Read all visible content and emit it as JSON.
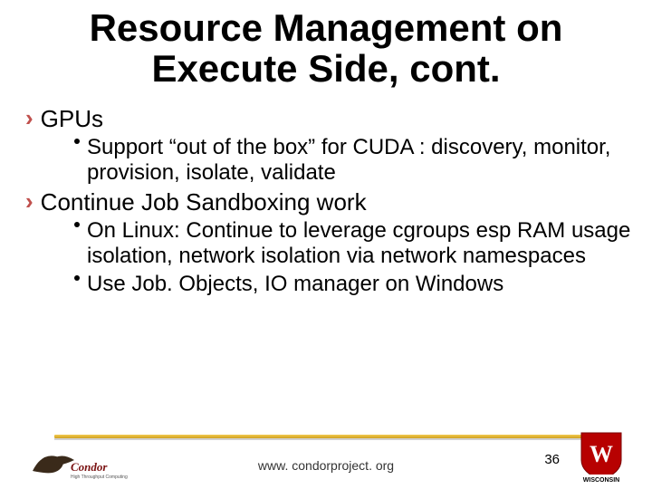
{
  "title": "Resource Management on Execute Side, cont.",
  "bullets": {
    "item0": {
      "label": "GPUs",
      "sub": {
        "s0": "Support “out of the box” for CUDA : discovery, monitor, provision, isolate, validate"
      }
    },
    "item1": {
      "label": "Continue Job Sandboxing work",
      "sub": {
        "s0": "On Linux: Continue to leverage cgroups esp RAM usage isolation, network isolation via network namespaces",
        "s1": "Use Job. Objects, IO manager on Windows"
      }
    }
  },
  "footer": {
    "url": "www. condorproject. org",
    "slide_number": "36"
  },
  "icons": {
    "chevron": "›"
  }
}
